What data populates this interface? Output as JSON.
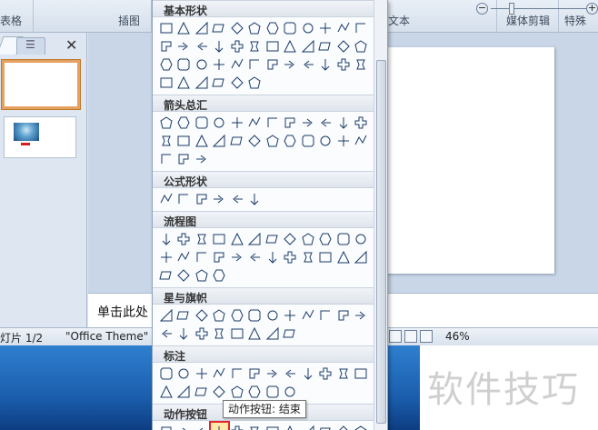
{
  "ribbon": {
    "groups": [
      {
        "label": "表格"
      },
      {
        "label": "插图"
      },
      {
        "label": "文本"
      },
      {
        "label": "媒体剪辑"
      },
      {
        "label": "特殊"
      }
    ]
  },
  "slide_pane": {
    "close_glyph": "✕",
    "outline_glyph": "☰"
  },
  "notes": {
    "placeholder": "单击此处"
  },
  "status": {
    "slide_info": "灯片 1/2",
    "theme": "\"Office Theme\"",
    "zoom": "46%",
    "zoom_minus": "−",
    "zoom_plus": "+"
  },
  "watermark": "软件技巧",
  "shapes_menu": {
    "categories": [
      {
        "label": "基本形状",
        "count": 42
      },
      {
        "label": "箭头总汇",
        "count": 27
      },
      {
        "label": "公式形状",
        "count": 6
      },
      {
        "label": "流程图",
        "count": 28
      },
      {
        "label": "星与旗帜",
        "count": 20
      },
      {
        "label": "标注",
        "count": 20
      },
      {
        "label": "动作按钮",
        "count": 12
      }
    ],
    "tooltip": "动作按钮: 结束",
    "selected": "动作按钮: 结束"
  }
}
